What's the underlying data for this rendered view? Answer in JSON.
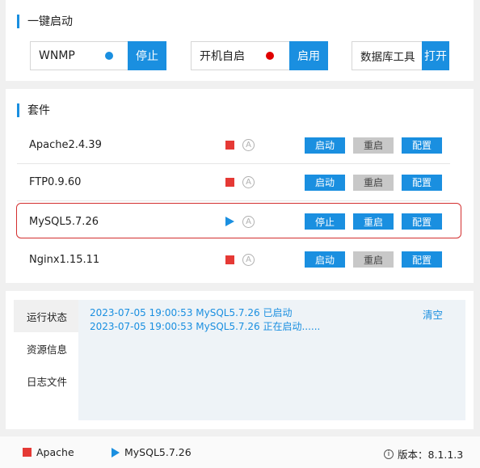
{
  "quick_start": {
    "title": "一键启动",
    "items": [
      {
        "label": "WNMP",
        "status_color": "#1a8fe0",
        "button": "停止"
      },
      {
        "label": "开机自启",
        "status_color": "#e00000",
        "button": "启用"
      },
      {
        "label": "数据库工具",
        "button": "打开"
      }
    ]
  },
  "suite": {
    "title": "套件",
    "services": [
      {
        "name": "Apache2.4.39",
        "status": "stopped",
        "btn_start": "启动",
        "btn_restart": "重启",
        "btn_config": "配置"
      },
      {
        "name": "FTP0.9.60",
        "status": "stopped",
        "btn_start": "启动",
        "btn_restart": "重启",
        "btn_config": "配置"
      },
      {
        "name": "MySQL5.7.26",
        "status": "running",
        "btn_start": "停止",
        "btn_restart": "重启",
        "btn_config": "配置"
      },
      {
        "name": "Nginx1.15.11",
        "status": "stopped",
        "btn_start": "启动",
        "btn_restart": "重启",
        "btn_config": "配置"
      }
    ],
    "auto_icon_glyph": "A"
  },
  "log": {
    "tabs": [
      "运行状态",
      "资源信息",
      "日志文件"
    ],
    "lines": [
      "2023-07-05 19:00:53 MySQL5.7.26 已启动",
      "2023-07-05 19:00:53 MySQL5.7.26 正在启动......"
    ],
    "clear_label": "清空"
  },
  "footer": {
    "apache_label": "Apache",
    "mysql_label": "MySQL5.7.26",
    "version_label": "版本：8.1.1.3",
    "info_glyph": "i"
  },
  "colors": {
    "accent": "#1a8fe0",
    "stopped": "#e53935",
    "highlight": "#d32f2f"
  }
}
